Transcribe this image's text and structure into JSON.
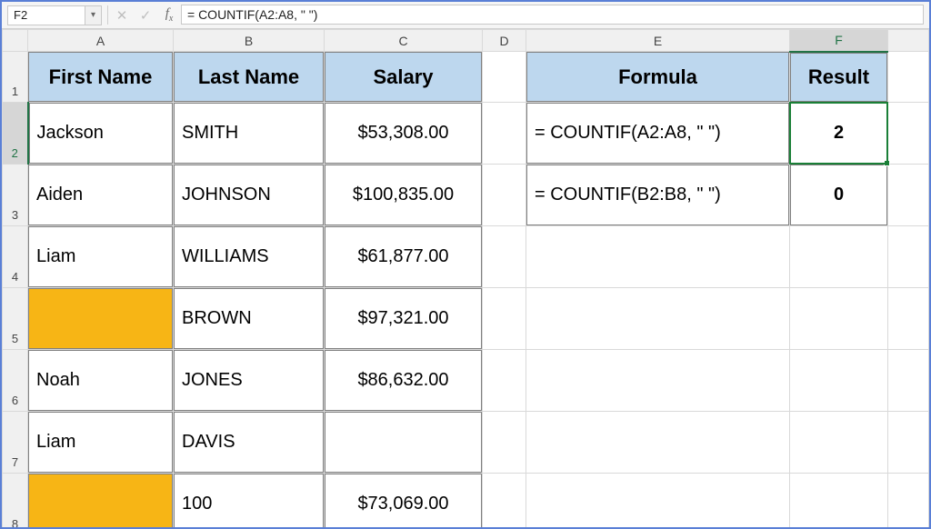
{
  "nameBox": "F2",
  "formulaBar": "= COUNTIF(A2:A8, \" \")",
  "columns": [
    "A",
    "B",
    "C",
    "D",
    "E",
    "F"
  ],
  "rowNumbers": [
    "1",
    "2",
    "3",
    "4",
    "5",
    "6",
    "7",
    "8"
  ],
  "leftTable": {
    "headers": {
      "A": "First Name",
      "B": "Last Name",
      "C": "Salary"
    },
    "rows": [
      {
        "A": "Jackson",
        "B": "SMITH",
        "C": "$53,308.00",
        "AFill": false
      },
      {
        "A": "Aiden",
        "B": "JOHNSON",
        "C": "$100,835.00",
        "AFill": false
      },
      {
        "A": "Liam",
        "B": "WILLIAMS",
        "C": "$61,877.00",
        "AFill": false
      },
      {
        "A": "",
        "B": "BROWN",
        "C": "$97,321.00",
        "AFill": true
      },
      {
        "A": "Noah",
        "B": "JONES",
        "C": "$86,632.00",
        "AFill": false
      },
      {
        "A": "Liam",
        "B": "DAVIS",
        "C": "",
        "AFill": false
      },
      {
        "A": "",
        "B": "100",
        "C": "$73,069.00",
        "AFill": true
      }
    ]
  },
  "rightTable": {
    "headers": {
      "E": "Formula",
      "F": "Result"
    },
    "rows": [
      {
        "E": "= COUNTIF(A2:A8, \" \")",
        "F": "2"
      },
      {
        "E": "= COUNTIF(B2:B8, \" \")",
        "F": "0"
      }
    ]
  },
  "selectedCell": "F2"
}
